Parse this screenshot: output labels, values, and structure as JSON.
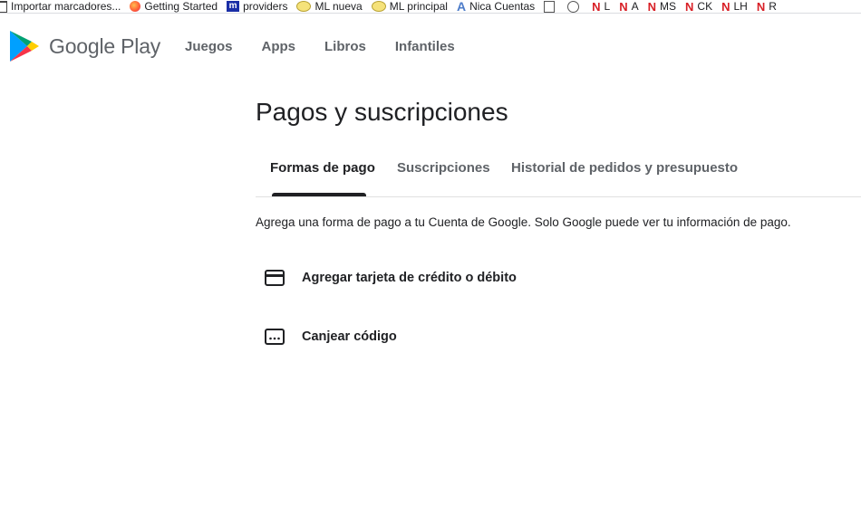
{
  "bookmarks": [
    {
      "icon": "folder-icon",
      "label": "Importar marcadores..."
    },
    {
      "icon": "firefox-icon",
      "label": "Getting Started"
    },
    {
      "icon": "m-icon",
      "label": "providers"
    },
    {
      "icon": "ml-icon",
      "label": "ML nueva"
    },
    {
      "icon": "ml-icon",
      "label": "ML principal"
    },
    {
      "icon": "a-icon",
      "label": "Nica Cuentas"
    },
    {
      "icon": "page-icon",
      "label": ""
    },
    {
      "icon": "globe-icon",
      "label": ""
    },
    {
      "icon": "netflix-icon",
      "label": "L"
    },
    {
      "icon": "netflix-icon",
      "label": "A"
    },
    {
      "icon": "netflix-icon",
      "label": "MS"
    },
    {
      "icon": "netflix-icon",
      "label": "CK"
    },
    {
      "icon": "netflix-icon",
      "label": "LH"
    },
    {
      "icon": "netflix-icon",
      "label": "R"
    }
  ],
  "header": {
    "brand": "Google Play",
    "nav": [
      "Juegos",
      "Apps",
      "Libros",
      "Infantiles"
    ]
  },
  "main": {
    "title": "Pagos y suscripciones",
    "tabs": [
      "Formas de pago",
      "Suscripciones",
      "Historial de pedidos y presupuesto"
    ],
    "active_tab": "Formas de pago",
    "description": "Agrega una forma de pago a tu Cuenta de Google. Solo Google puede ver tu información de pago.",
    "options": [
      {
        "icon": "credit-card-icon",
        "label": "Agregar tarjeta de crédito o débito"
      },
      {
        "icon": "redeem-code-icon",
        "label": "Canjear código"
      }
    ]
  },
  "colors": {
    "text_primary": "#202124",
    "text_secondary": "#5f6368",
    "divider": "#e0e0e0",
    "play_green": "#00a173",
    "play_blue": "#00a0ff",
    "play_yellow": "#ffce00",
    "play_red": "#f63448"
  }
}
